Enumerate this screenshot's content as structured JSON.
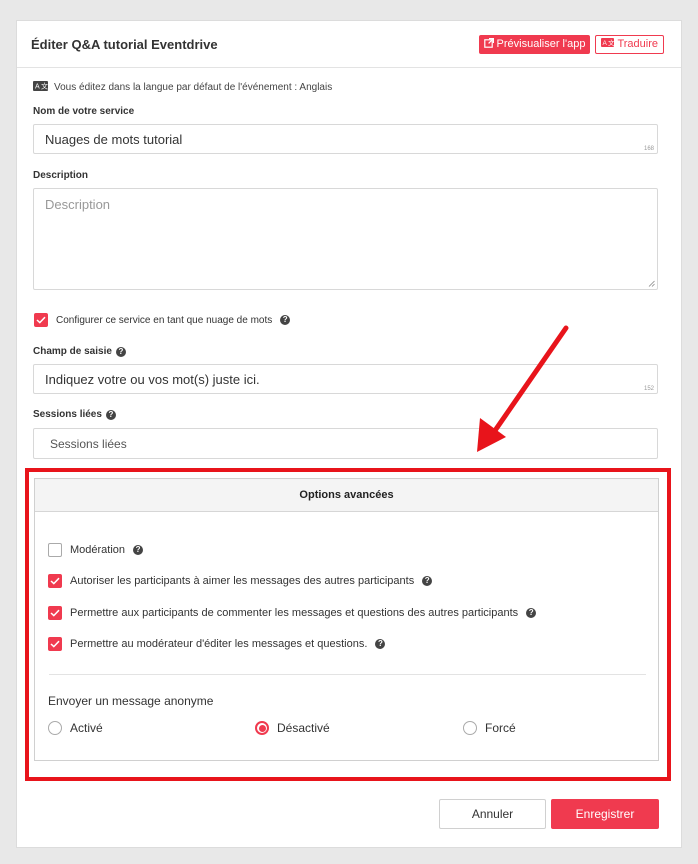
{
  "header": {
    "title": "Éditer Q&A tutorial Eventdrive",
    "preview_label": "Prévisualiser l'app",
    "translate_label": "Traduire"
  },
  "lang_note": "Vous éditez dans la langue par défaut de l'événement : Anglais",
  "service_name": {
    "label": "Nom de votre service",
    "value": "Nuages de mots tutorial",
    "counter": "168"
  },
  "description": {
    "label": "Description",
    "placeholder": "Description"
  },
  "wordcloud_checkbox": {
    "label": "Configurer ce service en tant que nuage de mots",
    "checked": true
  },
  "input_field": {
    "label": "Champ de saisie",
    "value": "Indiquez votre ou vos mot(s) juste ici.",
    "counter": "152"
  },
  "sessions": {
    "label": "Sessions liées",
    "placeholder": "Sessions liées"
  },
  "advanced": {
    "title": "Options avancées",
    "options": [
      {
        "label": "Modération",
        "checked": false,
        "help": true
      },
      {
        "label": "Autoriser les participants à aimer les messages des autres participants",
        "checked": true,
        "help": true
      },
      {
        "label": "Permettre aux participants de commenter les messages et questions des autres participants",
        "checked": true,
        "help": true
      },
      {
        "label": "Permettre au modérateur d'éditer les messages et questions.",
        "checked": true,
        "help": true
      }
    ],
    "anonymous": {
      "label": "Envoyer un message anonyme",
      "choices": [
        {
          "label": "Activé",
          "selected": false
        },
        {
          "label": "Désactivé",
          "selected": true
        },
        {
          "label": "Forcé",
          "selected": false
        }
      ]
    }
  },
  "footer": {
    "cancel_label": "Annuler",
    "save_label": "Enregistrer"
  },
  "colors": {
    "accent": "#f03a4f",
    "highlight": "#e8141b"
  }
}
